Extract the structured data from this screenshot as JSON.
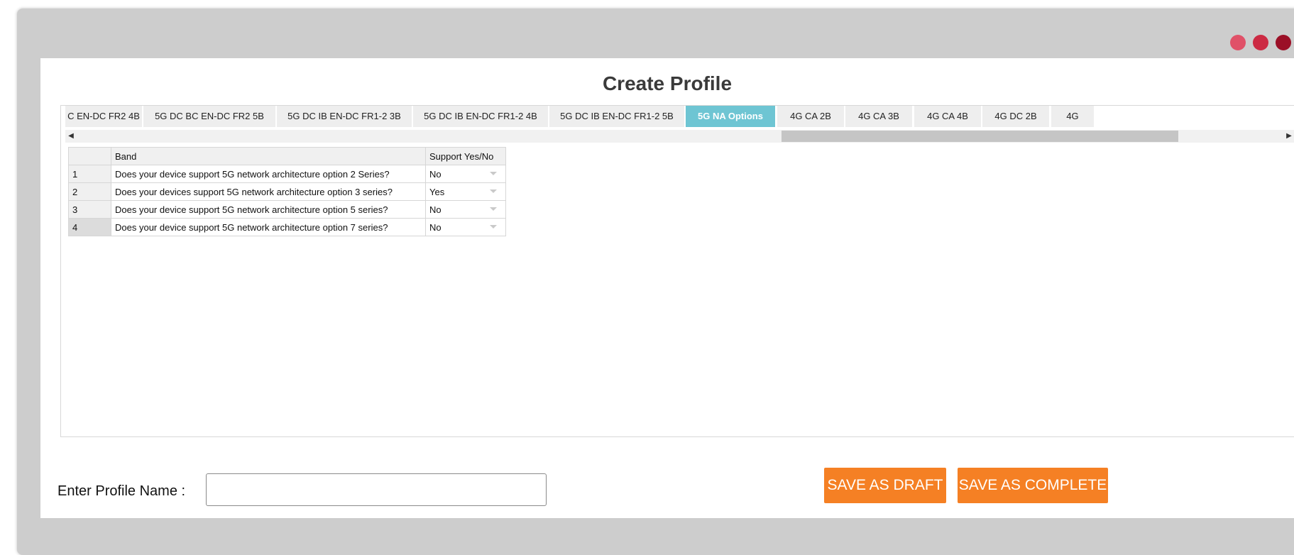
{
  "window": {
    "dot_colors": [
      "#e05168",
      "#cc2a43",
      "#9b1027"
    ]
  },
  "page": {
    "title": "Create Profile"
  },
  "tabs": [
    {
      "label": "C EN-DC FR2 4B"
    },
    {
      "label": "5G DC BC EN-DC FR2 5B"
    },
    {
      "label": "5G DC IB EN-DC FR1-2 3B"
    },
    {
      "label": "5G DC IB EN-DC FR1-2 4B"
    },
    {
      "label": "5G DC IB EN-DC FR1-2 5B"
    },
    {
      "label": "5G NA Options",
      "active": true
    },
    {
      "label": "4G CA 2B"
    },
    {
      "label": "4G CA 3B"
    },
    {
      "label": "4G CA 4B"
    },
    {
      "label": "4G DC 2B"
    },
    {
      "label": "4G"
    }
  ],
  "table": {
    "headers": {
      "band": "Band",
      "support": "Support Yes/No"
    },
    "rows": [
      {
        "num": "1",
        "question": "Does your device support 5G network architecture option 2 Series?",
        "answer": "No"
      },
      {
        "num": "2",
        "question": "Does your devices support 5G network architecture option 3 series?",
        "answer": "Yes"
      },
      {
        "num": "3",
        "question": "Does your device support 5G network architecture option 5 series?",
        "answer": "No"
      },
      {
        "num": "4",
        "question": "Does your device support 5G network architecture option 7 series?",
        "answer": "No"
      }
    ]
  },
  "form": {
    "profile_name_label": "Enter Profile Name :",
    "profile_name_value": "",
    "save_draft_label": "SAVE AS DRAFT",
    "save_complete_label": "SAVE AS COMPLETE"
  },
  "colors": {
    "accent_button": "#f58024",
    "active_tab": "#6ec5d3"
  },
  "icons": {
    "scroll_left": "arrow-left-icon",
    "scroll_right": "arrow-right-icon",
    "dropdown": "dropdown-caret-icon"
  }
}
